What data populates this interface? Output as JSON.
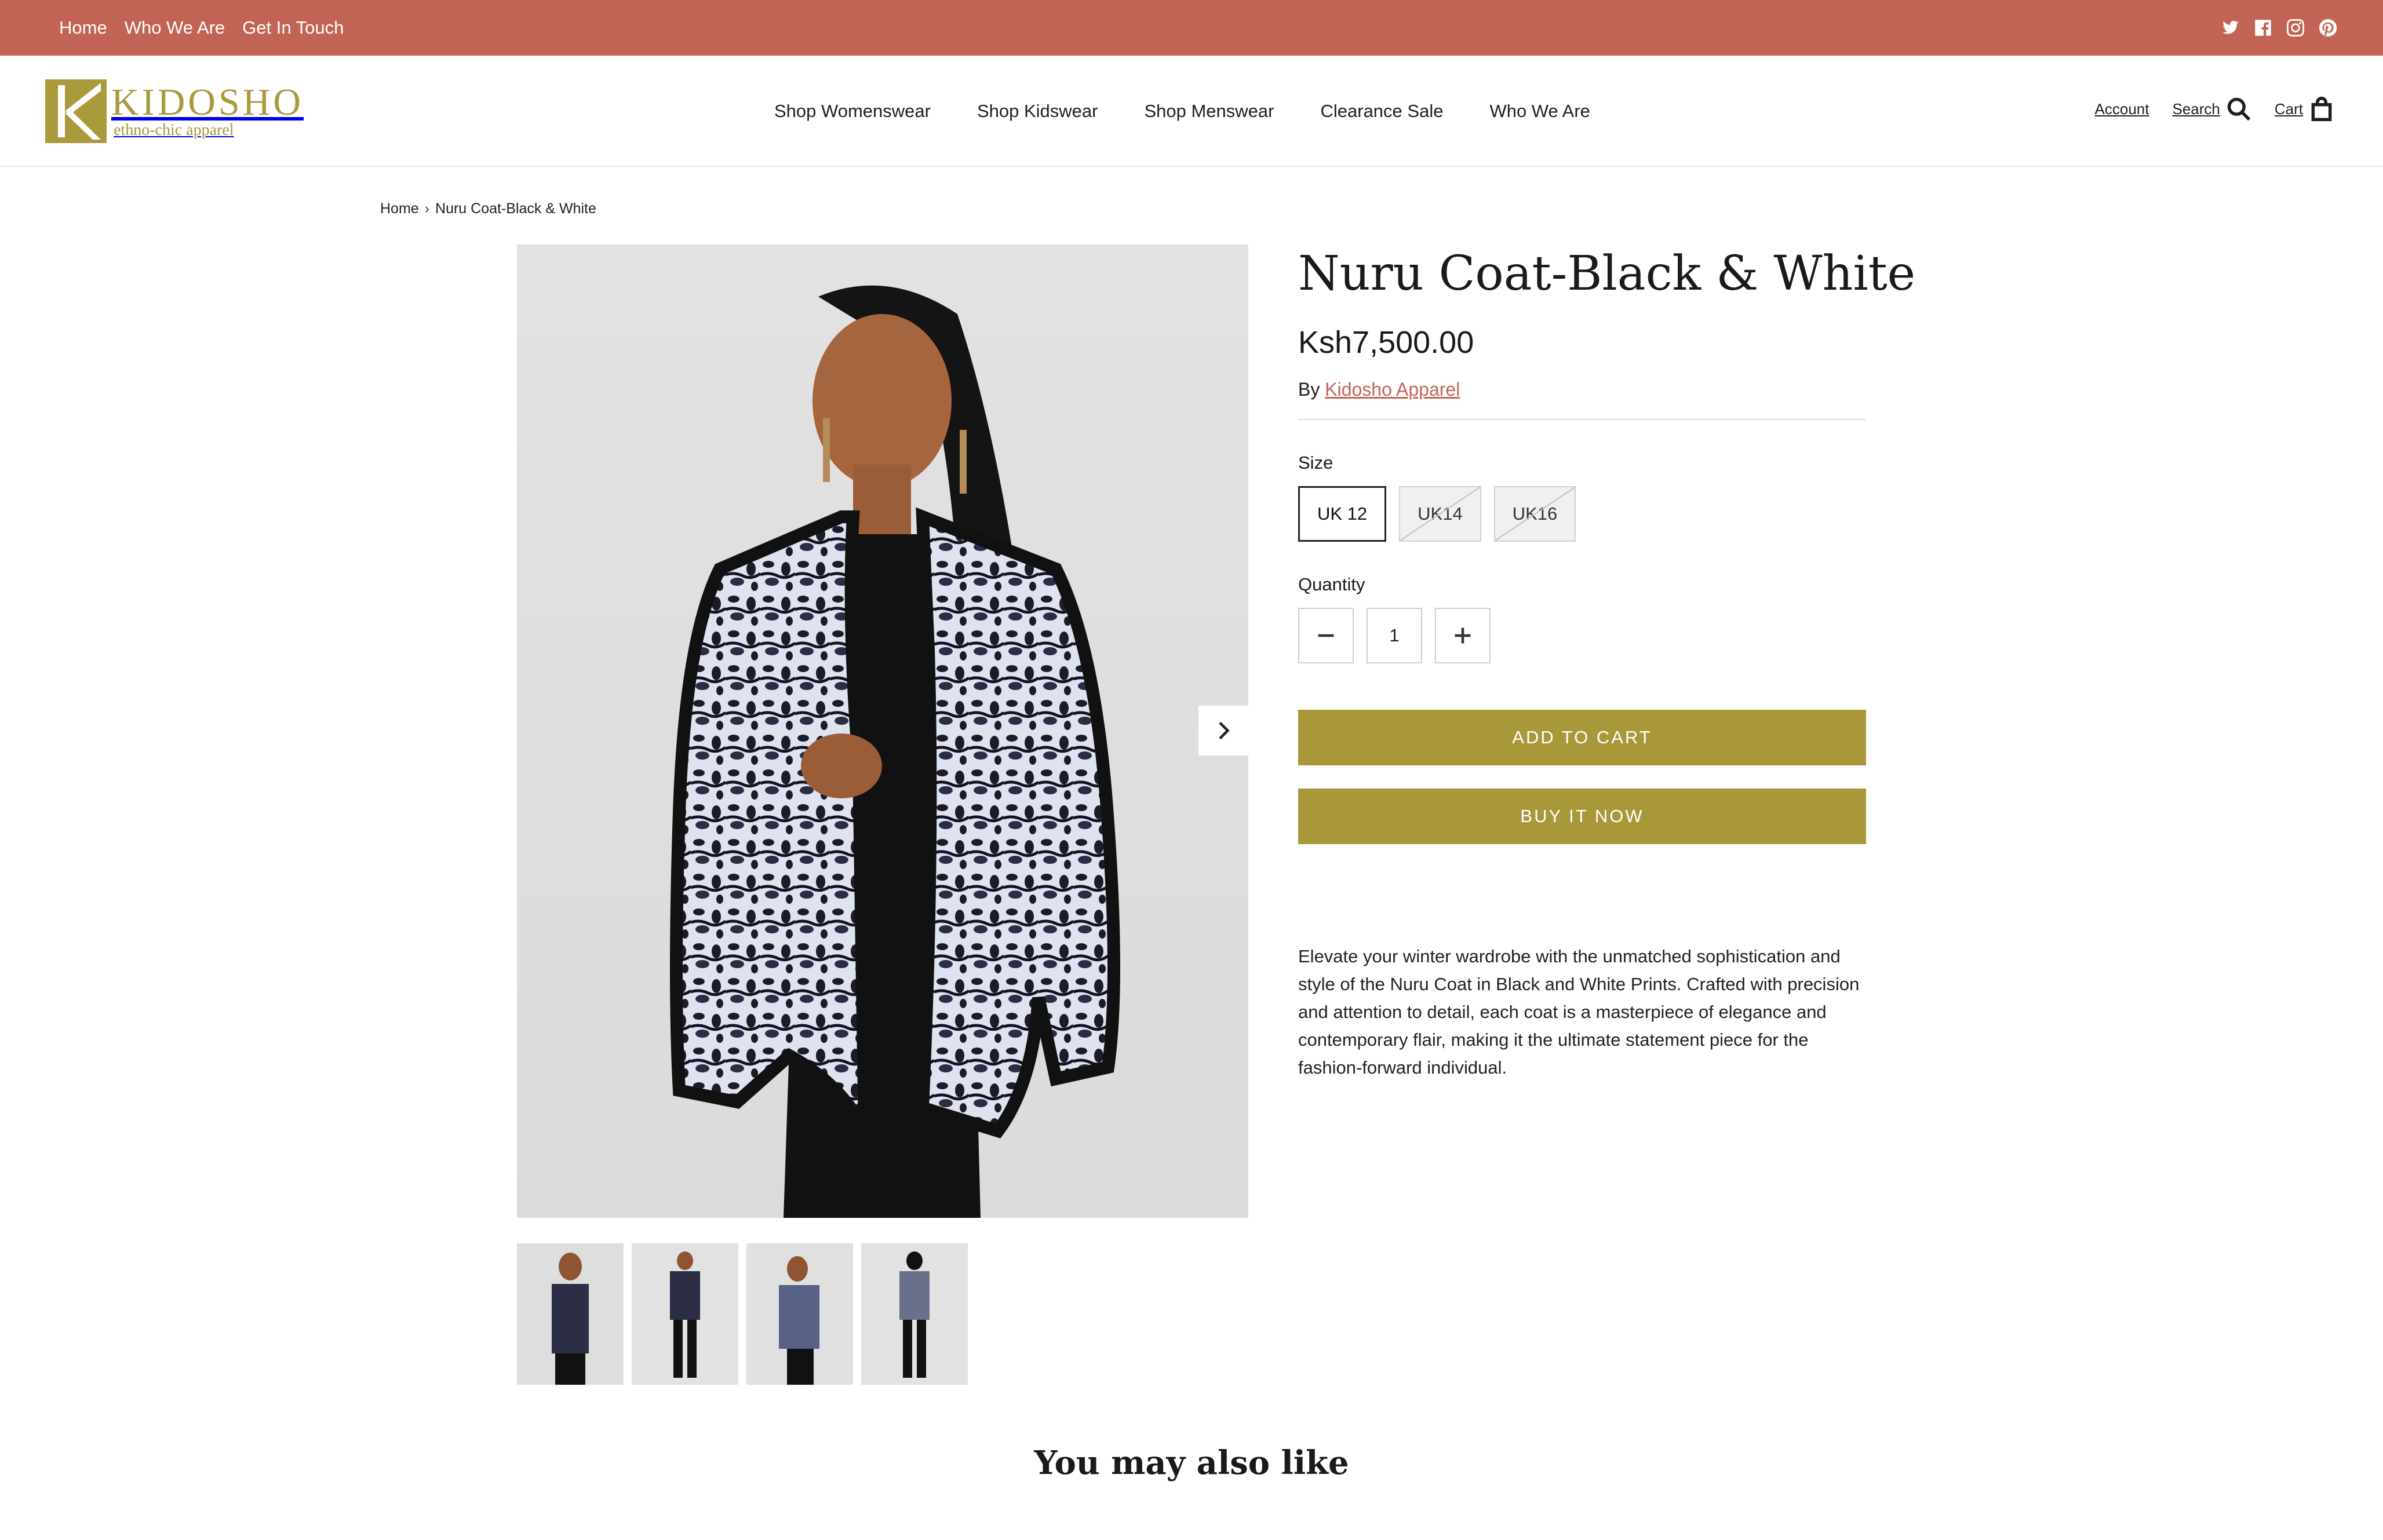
{
  "colors": {
    "topbar": "#c26455",
    "accent_button": "#a9983a",
    "logo": "#a99a3c",
    "vendor_link": "#c26455"
  },
  "topbar": {
    "links": [
      "Home",
      "Who We Are",
      "Get In Touch"
    ],
    "socials": [
      "twitter-icon",
      "facebook-icon",
      "instagram-icon",
      "pinterest-icon"
    ]
  },
  "header": {
    "logo_name": "KIDOSHO",
    "logo_tagline": "ethno-chic apparel",
    "nav": [
      "Shop Womenswear",
      "Shop Kidswear",
      "Shop Menswear",
      "Clearance Sale",
      "Who We Are"
    ],
    "account": "Account",
    "search": "Search",
    "cart": "Cart"
  },
  "breadcrumb": {
    "home": "Home",
    "current": "Nuru Coat-Black & White"
  },
  "product": {
    "title": "Nuru Coat-Black & White",
    "price": "Ksh7,500.00",
    "by": "By",
    "vendor": "Kidosho Apparel",
    "size_label": "Size",
    "sizes": [
      {
        "label": "UK 12",
        "selected": true,
        "available": true
      },
      {
        "label": "UK14",
        "selected": false,
        "available": false
      },
      {
        "label": "UK16",
        "selected": false,
        "available": false
      }
    ],
    "quantity_label": "Quantity",
    "quantity": "1",
    "add_to_cart": "ADD TO CART",
    "buy_now": "BUY IT NOW",
    "description": "Elevate your winter wardrobe with the unmatched sophistication and style of the Nuru Coat in Black and White Prints. Crafted with precision and attention to detail, each coat is a masterpiece of elegance and contemporary flair, making it the ultimate statement piece for the fashion-forward individual.",
    "thumbnail_count": 4
  },
  "recommendations": {
    "heading": "You may also like"
  }
}
